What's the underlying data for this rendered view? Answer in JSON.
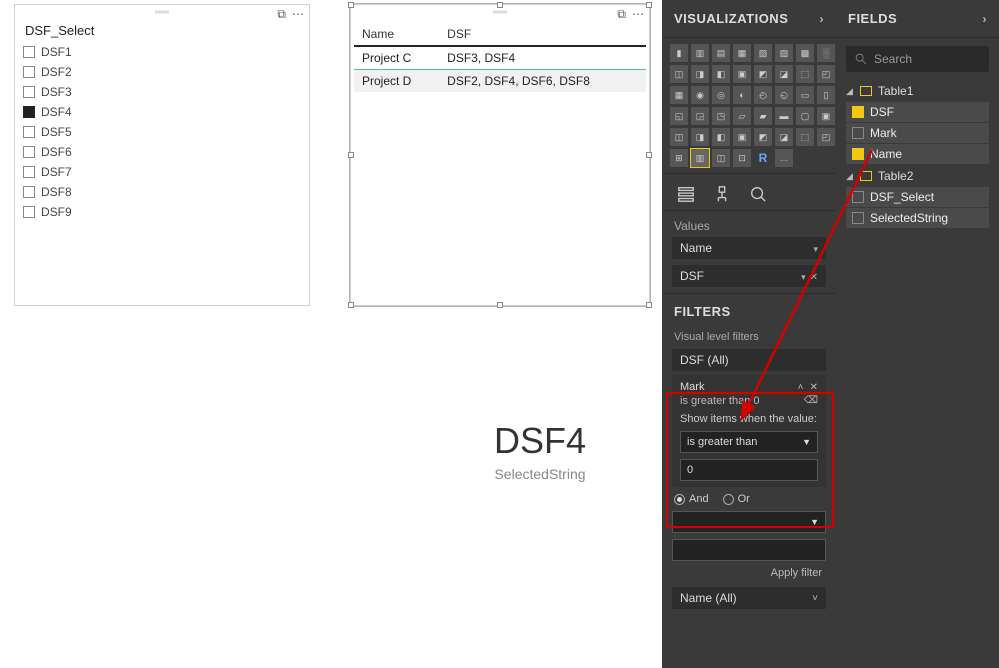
{
  "slicer": {
    "title": "DSF_Select",
    "items": [
      "DSF1",
      "DSF2",
      "DSF3",
      "DSF4",
      "DSF5",
      "DSF6",
      "DSF7",
      "DSF8",
      "DSF9"
    ],
    "checked_index": 3
  },
  "table": {
    "headers": [
      "Name",
      "DSF"
    ],
    "rows": [
      {
        "name": "Project C",
        "dsf": "DSF3, DSF4"
      },
      {
        "name": "Project D",
        "dsf": "DSF2, DSF4, DSF6, DSF8"
      }
    ]
  },
  "card": {
    "value": "DSF4",
    "label": "SelectedString"
  },
  "viz_pane": {
    "title": "VISUALIZATIONS",
    "values_label": "Values",
    "wells": [
      "Name",
      "DSF"
    ],
    "filters_title": "FILTERS",
    "visual_level_label": "Visual level filters",
    "filter_dsf": "DSF (All)",
    "filter_name_all": "Name (All)",
    "mark_filter": {
      "field": "Mark",
      "condition_text": "is greater than 0",
      "show_items_label": "Show items when the value:",
      "operator": "is greater than",
      "value": "0",
      "and_label": "And",
      "or_label": "Or"
    },
    "apply_label": "Apply filter"
  },
  "fields_pane": {
    "title": "FIELDS",
    "search_placeholder": "Search",
    "tables": [
      {
        "name": "Table1",
        "expanded": true,
        "fields": [
          {
            "name": "DSF",
            "checked": true
          },
          {
            "name": "Mark",
            "checked": false
          },
          {
            "name": "Name",
            "checked": true
          }
        ]
      },
      {
        "name": "Table2",
        "expanded": true,
        "fields": [
          {
            "name": "DSF_Select",
            "checked": false
          },
          {
            "name": "SelectedString",
            "checked": false
          }
        ]
      }
    ]
  }
}
